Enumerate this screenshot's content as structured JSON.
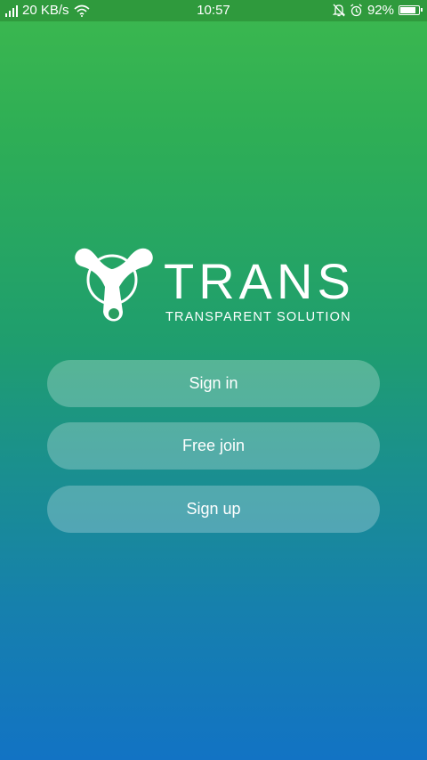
{
  "status_bar": {
    "network_speed": "20 KB/s",
    "time": "10:57",
    "battery_percent": "92%",
    "battery_level": 0.92,
    "icons": [
      "signal-icon",
      "wifi-icon",
      "notification-off-icon",
      "alarm-icon",
      "battery-icon"
    ]
  },
  "logo": {
    "title": "TRANS",
    "subtitle": "TRANSPARENT SOLUTION"
  },
  "buttons": {
    "sign_in": "Sign in",
    "free_join": "Free join",
    "sign_up": "Sign up"
  },
  "colors": {
    "gradient_top": "#3cb84e",
    "gradient_bottom": "#1273c4",
    "status_bar_bg": "#2f9a3d",
    "text": "#ffffff"
  }
}
